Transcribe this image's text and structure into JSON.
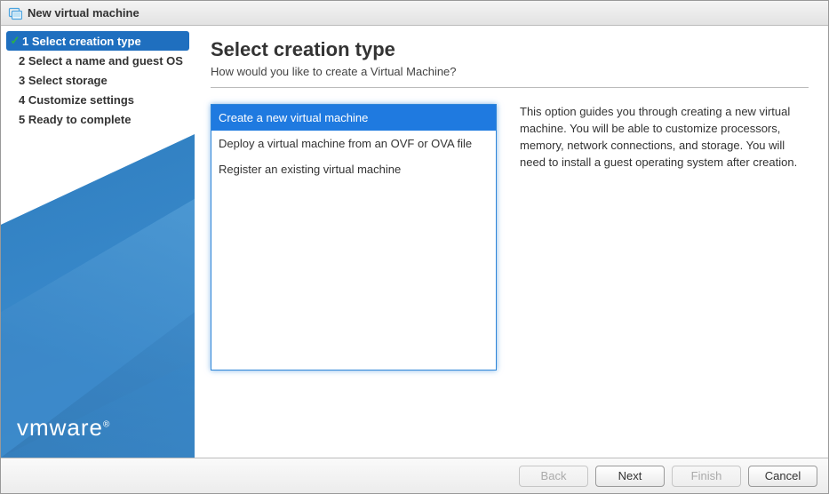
{
  "titlebar": {
    "title": "New virtual machine"
  },
  "sidebar": {
    "steps": [
      {
        "label": "1 Select creation type"
      },
      {
        "label": "2 Select a name and guest OS"
      },
      {
        "label": "3 Select storage"
      },
      {
        "label": "4 Customize settings"
      },
      {
        "label": "5 Ready to complete"
      }
    ],
    "brand": "vmware"
  },
  "main": {
    "title": "Select creation type",
    "subtitle": "How would you like to create a Virtual Machine?",
    "options": [
      "Create a new virtual machine",
      "Deploy a virtual machine from an OVF or OVA file",
      "Register an existing virtual machine"
    ],
    "description": "This option guides you through creating a new virtual machine. You will be able to customize processors, memory, network connections, and storage. You will need to install a guest operating system after creation."
  },
  "footer": {
    "back": "Back",
    "next": "Next",
    "finish": "Finish",
    "cancel": "Cancel"
  }
}
